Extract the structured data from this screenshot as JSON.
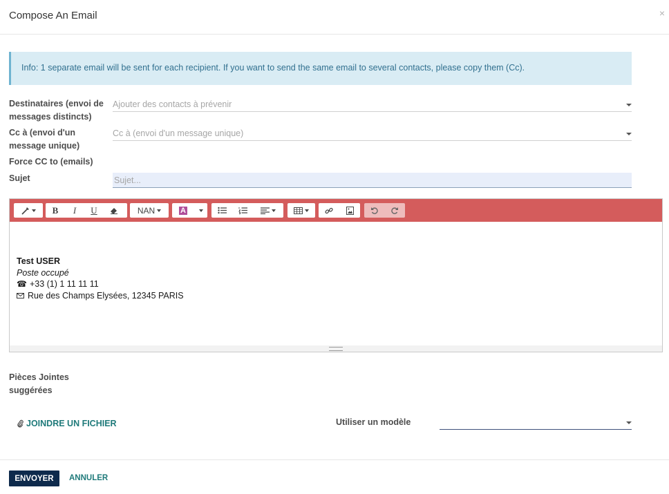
{
  "dialog": {
    "title": "Compose An Email",
    "close_glyph": "×"
  },
  "info": {
    "text": "Info: 1 separate email will be sent for each recipient. If you want to send the same email to several contacts, please copy them (Cc)."
  },
  "fields": {
    "recipients": {
      "label_line1": "Destinataires (envoi de",
      "label_line2": "messages distincts)",
      "placeholder": "Ajouter des contacts à prévenir"
    },
    "cc": {
      "label_line1": "Cc à (envoi d'un",
      "label_line2": "message unique)",
      "placeholder": "Cc à (envoi d'un message unique)"
    },
    "force_cc": {
      "label": "Force CC to (emails)"
    },
    "subject": {
      "label": "Sujet",
      "placeholder": "Sujet...",
      "value": ""
    }
  },
  "toolbar": {
    "font_label": "NAN",
    "accent_color": "#d45c5c",
    "icons": [
      "magic-wand-icon",
      "bold-icon",
      "italic-icon",
      "underline-icon",
      "eraser-icon",
      "font-color-icon",
      "bullet-list-icon",
      "numbered-list-icon",
      "align-icon",
      "table-icon",
      "link-icon",
      "image-icon",
      "undo-icon",
      "redo-icon"
    ],
    "bold": "B",
    "italic": "I",
    "underline": "U",
    "font_color_letter": "A"
  },
  "signature": {
    "name": "Test USER",
    "position": "Poste occupé",
    "phone": "+33 (1) 1 11 11 11",
    "address": "Rue des Champs Elysées, 12345 PARIS"
  },
  "attachments": {
    "label_line1": "Pièces Jointes",
    "label_line2": "suggérées",
    "attach_button": "JOINDRE UN FICHIER"
  },
  "template": {
    "label": "Utiliser un modèle",
    "value": ""
  },
  "actions": {
    "send": "ENVOYER",
    "cancel": "ANNULER"
  },
  "colors": {
    "primary": "#0e2a4c",
    "link": "#1f7a7a",
    "info_bg": "#d9ecf4"
  }
}
